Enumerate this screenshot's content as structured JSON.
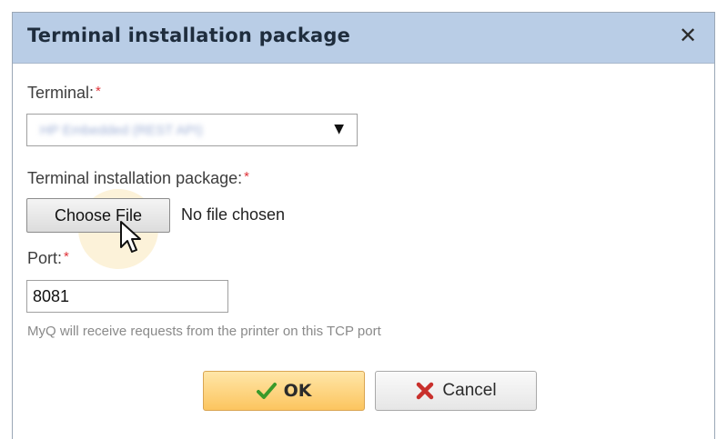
{
  "dialog": {
    "title": "Terminal installation package",
    "close_glyph": "✕"
  },
  "form": {
    "terminal": {
      "label": "Terminal:",
      "required_mark": "*",
      "selected_value": "HP Embedded (REST API)",
      "arrow_glyph": "▼"
    },
    "package": {
      "label": "Terminal installation package:",
      "required_mark": "*",
      "choose_label": "Choose File",
      "status": "No file chosen"
    },
    "port": {
      "label": "Port:",
      "required_mark": "*",
      "value": "8081",
      "hint": "MyQ will receive requests from the printer on this TCP port"
    }
  },
  "buttons": {
    "ok_label": "OK",
    "ok_icon": "check-icon",
    "cancel_label": "Cancel",
    "cancel_icon": "cross-icon"
  },
  "colors": {
    "titlebar": "#b9cde6",
    "required": "#e0343a",
    "ok_button": "#fcc55f",
    "check_green": "#3a9a2a",
    "cross_red": "#c9302c"
  }
}
